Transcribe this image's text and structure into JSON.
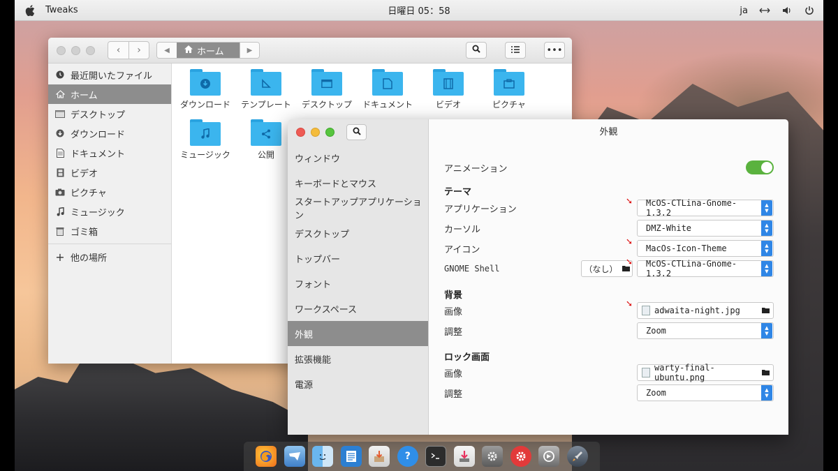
{
  "top_panel": {
    "app_name": "Tweaks",
    "clock": "日曜日 05：58",
    "lang": "ja",
    "icons": [
      "apple-icon",
      "network-icon",
      "volume-icon",
      "power-icon"
    ]
  },
  "file_manager": {
    "path_label": "ホーム",
    "sidebar": {
      "items": [
        {
          "label": "最近開いたファイル",
          "icon": "recent-icon"
        },
        {
          "label": "ホーム",
          "icon": "home-icon",
          "active": true
        },
        {
          "label": "デスクトップ",
          "icon": "desktop-icon"
        },
        {
          "label": "ダウンロード",
          "icon": "download-icon"
        },
        {
          "label": "ドキュメント",
          "icon": "document-icon"
        },
        {
          "label": "ビデオ",
          "icon": "video-icon"
        },
        {
          "label": "ピクチャ",
          "icon": "camera-icon"
        },
        {
          "label": "ミュージック",
          "icon": "music-icon"
        },
        {
          "label": "ゴミ箱",
          "icon": "trash-icon"
        }
      ],
      "other_locations": "他の場所"
    },
    "files": [
      {
        "label": "ダウンロード",
        "icon": "download-folder-icon"
      },
      {
        "label": "テンプレート",
        "icon": "template-folder-icon"
      },
      {
        "label": "デスクトップ",
        "icon": "desktop-folder-icon"
      },
      {
        "label": "ドキュメント",
        "icon": "document-folder-icon"
      },
      {
        "label": "ビデオ",
        "icon": "video-folder-icon"
      },
      {
        "label": "ピクチャ",
        "icon": "picture-folder-icon"
      },
      {
        "label": "ミュージック",
        "icon": "music-folder-icon"
      },
      {
        "label": "公開",
        "icon": "share-folder-icon"
      }
    ]
  },
  "tweaks": {
    "title": "外観",
    "nav": [
      {
        "label": "ウィンドウ"
      },
      {
        "label": "キーボードとマウス"
      },
      {
        "label": "スタートアップアプリケーション"
      },
      {
        "label": "デスクトップ"
      },
      {
        "label": "トップバー"
      },
      {
        "label": "フォント"
      },
      {
        "label": "ワークスペース"
      },
      {
        "label": "外観",
        "active": true
      },
      {
        "label": "拡張機能"
      },
      {
        "label": "電源"
      }
    ],
    "animation_label": "アニメーション",
    "animation_on": true,
    "theme_section": "テーマ",
    "applications_label": "アプリケーション",
    "applications_value": "McOS-CTLina-Gnome-1.3.2",
    "cursor_label": "カーソル",
    "cursor_value": "DMZ-White",
    "icons_label": "アイコン",
    "icons_value": "MacOs-Icon-Theme",
    "shell_label": "GNOME Shell",
    "shell_none": "（なし）",
    "shell_value": "McOS-CTLina-Gnome-1.3.2",
    "background_section": "背景",
    "bg_image_label": "画像",
    "bg_image_value": "adwaita-night.jpg",
    "bg_adjust_label": "調整",
    "bg_adjust_value": "Zoom",
    "lock_section": "ロック画面",
    "lock_image_label": "画像",
    "lock_image_value": "warty-final-ubuntu.png",
    "lock_adjust_label": "調整",
    "lock_adjust_value": "Zoom",
    "accent_color": "#2f86e6",
    "toggle_color": "#5ab23e"
  },
  "dock": {
    "icons": [
      "firefox-icon",
      "mail-icon",
      "finder-icon",
      "notes-icon",
      "installer-icon",
      "help-icon",
      "terminal-icon",
      "download-icon",
      "settings-icon",
      "app-store-icon",
      "tweaks-icon",
      "launchpad-icon"
    ]
  }
}
